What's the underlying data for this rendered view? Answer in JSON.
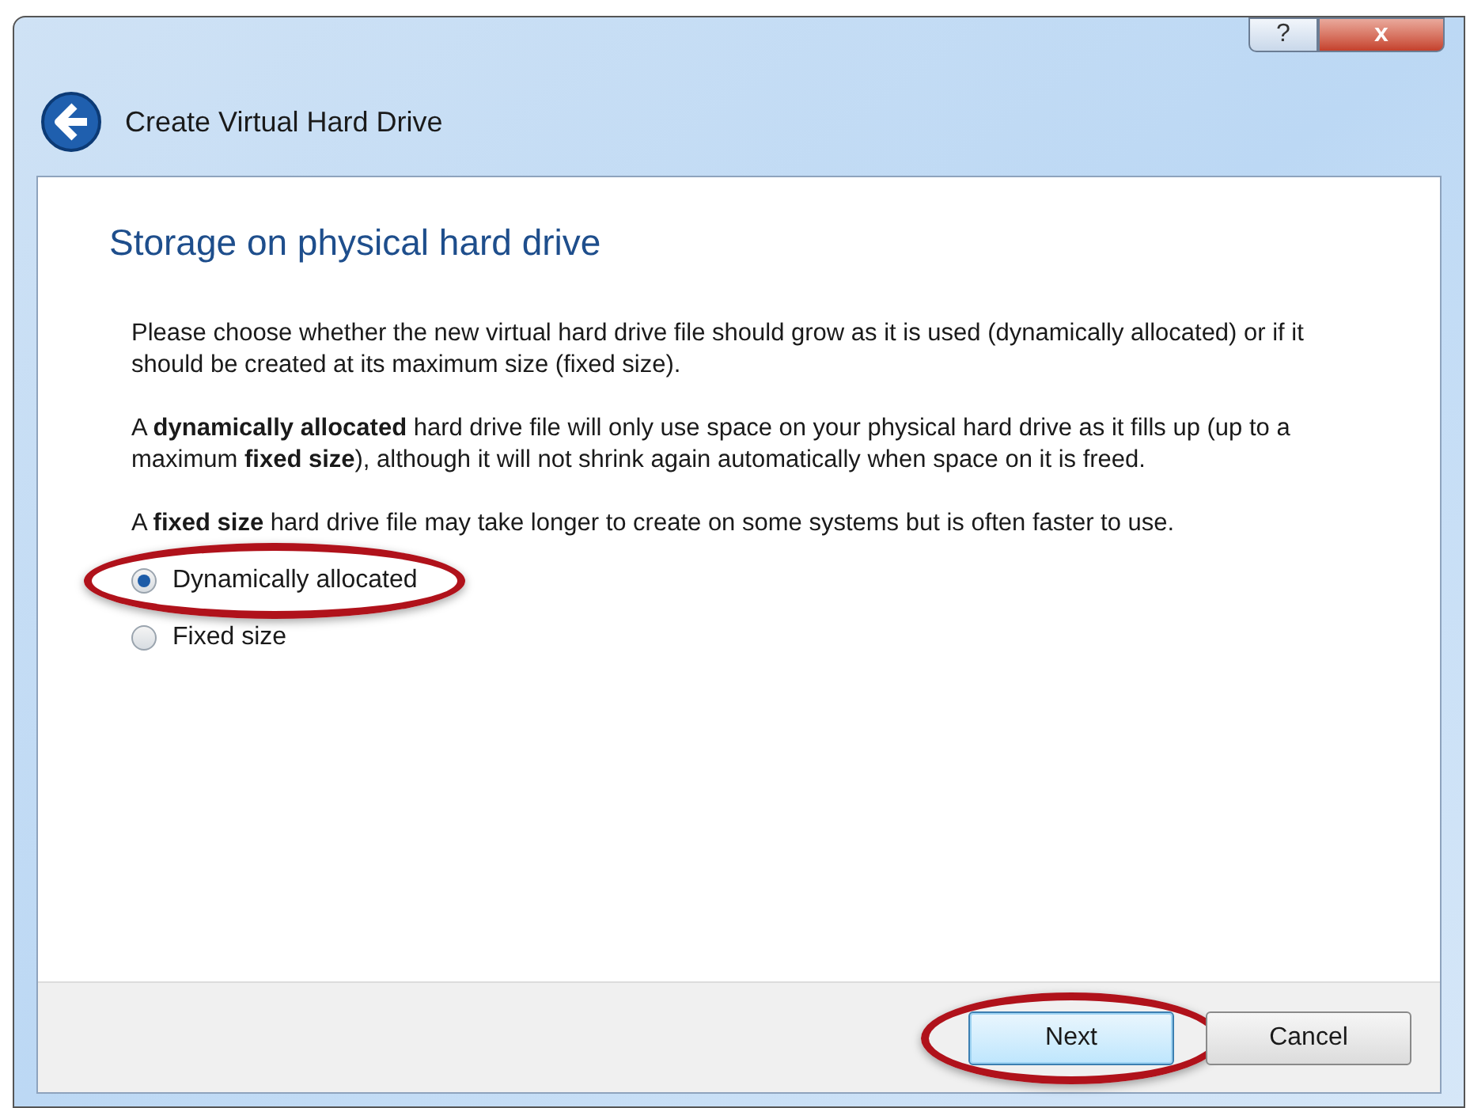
{
  "window": {
    "title": "Create Virtual Hard Drive"
  },
  "title_buttons": [
    {
      "kind": "help",
      "label": "?"
    },
    {
      "kind": "close",
      "label": "x"
    }
  ],
  "heading": "Storage on physical hard drive",
  "paragraphs": [
    "Please choose whether the new virtual hard drive file should grow as it is used (dynamically allocated) or if it should be created at its maximum size (fixed size).",
    "A **dynamically allocated** hard drive file will only use space on your physical hard drive as it fills up (up to a maximum **fixed size**), although it will not shrink again automatically when space on it is freed.",
    "A **fixed size** hard drive file may take longer to create on some systems but is often faster to use."
  ],
  "options": [
    {
      "label": "Dynamically allocated",
      "selected": true,
      "highlighted": true
    },
    {
      "label": "Fixed size",
      "selected": false,
      "highlighted": false
    }
  ],
  "buttons": [
    {
      "label": "Next",
      "default": true,
      "highlighted": true
    },
    {
      "label": "Cancel",
      "default": false,
      "highlighted": false
    }
  ]
}
